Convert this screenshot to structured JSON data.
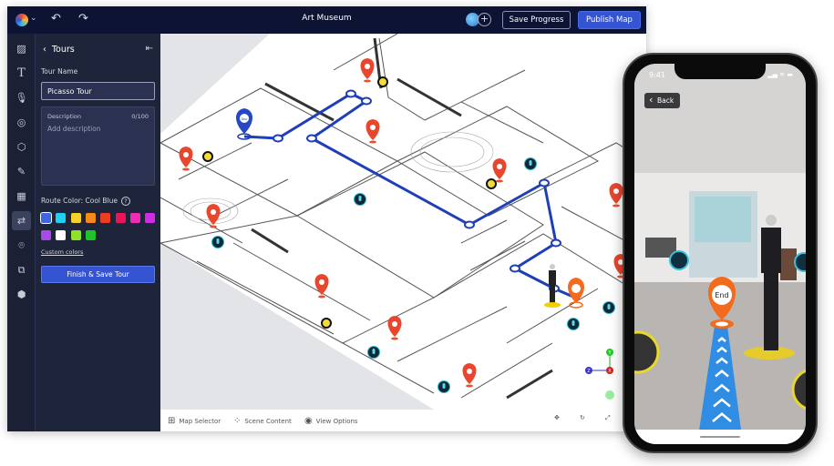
{
  "header": {
    "title": "Art Museum",
    "save_label": "Save Progress",
    "publish_label": "Publish Map",
    "undo_icon": "undo-icon",
    "redo_icon": "redo-icon"
  },
  "rail": {
    "items": [
      "image-icon",
      "text-icon",
      "microphone-icon",
      "target-icon",
      "cube-icon",
      "edit-icon",
      "grid-icon",
      "route-icon",
      "location-pin-icon",
      "layers-icon",
      "box-stack-icon"
    ],
    "active": "route-icon"
  },
  "panel": {
    "title": "Tours",
    "tour_name_label": "Tour Name",
    "tour_name_value": "Picasso Tour",
    "description_label": "Description",
    "description_count": "0/100",
    "description_placeholder": "Add description",
    "route_color_label": "Route Color: Cool Blue",
    "swatches": [
      "#3f66e0",
      "#1fd0f0",
      "#f5d02a",
      "#f58a1a",
      "#ef3b22",
      "#e8155a",
      "#f02cb4",
      "#d02ce8",
      "#a94ae8",
      "#ffffff",
      "#8ee22a",
      "#20c42a"
    ],
    "selected_swatch": "#3f66e0",
    "custom_colors_label": "Custom colors",
    "finish_label": "Finish & Save Tour"
  },
  "map": {
    "route_color": "#1f3fb8",
    "start_pin_label": "Tour",
    "end_pin_color": "#f36b1c",
    "axes": [
      "Y",
      "Z",
      "X"
    ]
  },
  "toolbar": {
    "map_selector": "Map Selector",
    "scene_content": "Scene Content",
    "view_options": "View Options"
  },
  "phone": {
    "time": "9:41",
    "back_label": "Back",
    "end_label": "End",
    "status_icons": "▂▄ ≋ ▬"
  }
}
